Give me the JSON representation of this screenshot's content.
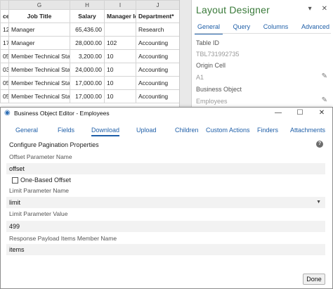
{
  "spreadsheet": {
    "column_letters": [
      "",
      "G",
      "H",
      "I",
      "J"
    ],
    "headers": [
      "ce",
      "Job Title",
      "Salary",
      "Manager Id",
      "Department*"
    ],
    "rows": [
      [
        "12",
        "Manager",
        "65,436.00",
        "",
        "Research"
      ],
      [
        "17",
        "Manager",
        "28,000.00",
        "102",
        "Accounting"
      ],
      [
        "05",
        "Member Technical Staff",
        "3,200.00",
        "10",
        "Accounting"
      ],
      [
        "03",
        "Member Technical Staff",
        "24,000.00",
        "10",
        "Accounting"
      ],
      [
        "05",
        "Member Technical Staff",
        "17,000.00",
        "10",
        "Accounting"
      ],
      [
        "05",
        "Member Technical Staff",
        "17,000.00",
        "10",
        "Accounting"
      ]
    ]
  },
  "designer": {
    "title": "Layout Designer",
    "tabs": [
      "General",
      "Query",
      "Columns",
      "Advanced"
    ],
    "table_id_label": "Table ID",
    "table_id_value": "TBL731992735",
    "origin_cell_label": "Origin Cell",
    "origin_cell_value": "A1",
    "business_object_label": "Business Object",
    "business_object_value": "Employees"
  },
  "dialog": {
    "title": "Business Object Editor - Employees",
    "tabs": [
      "General",
      "Fields",
      "Download",
      "Upload",
      "Children",
      "Custom Actions",
      "Finders",
      "Attachments"
    ],
    "active_tab": "Download",
    "section_title": "Configure Pagination Properties",
    "offset_param_label": "Offset Parameter Name",
    "offset_param_value": "offset",
    "one_based_label": "One-Based Offset",
    "limit_param_label": "Limit Parameter Name",
    "limit_param_value": "limit",
    "limit_value_label": "Limit Parameter Value",
    "limit_value": "499",
    "payload_label": "Response Payload Items Member Name",
    "payload_value": "items",
    "done_label": "Done"
  },
  "colors": {
    "accent_blue": "#1f5fa8",
    "designer_title_green": "#3a7a3a"
  },
  "icons": [
    "close-icon",
    "pencil-icon",
    "business-object-icon",
    "minimize-icon",
    "maximize-icon",
    "help-icon",
    "chevron-down-icon"
  ]
}
